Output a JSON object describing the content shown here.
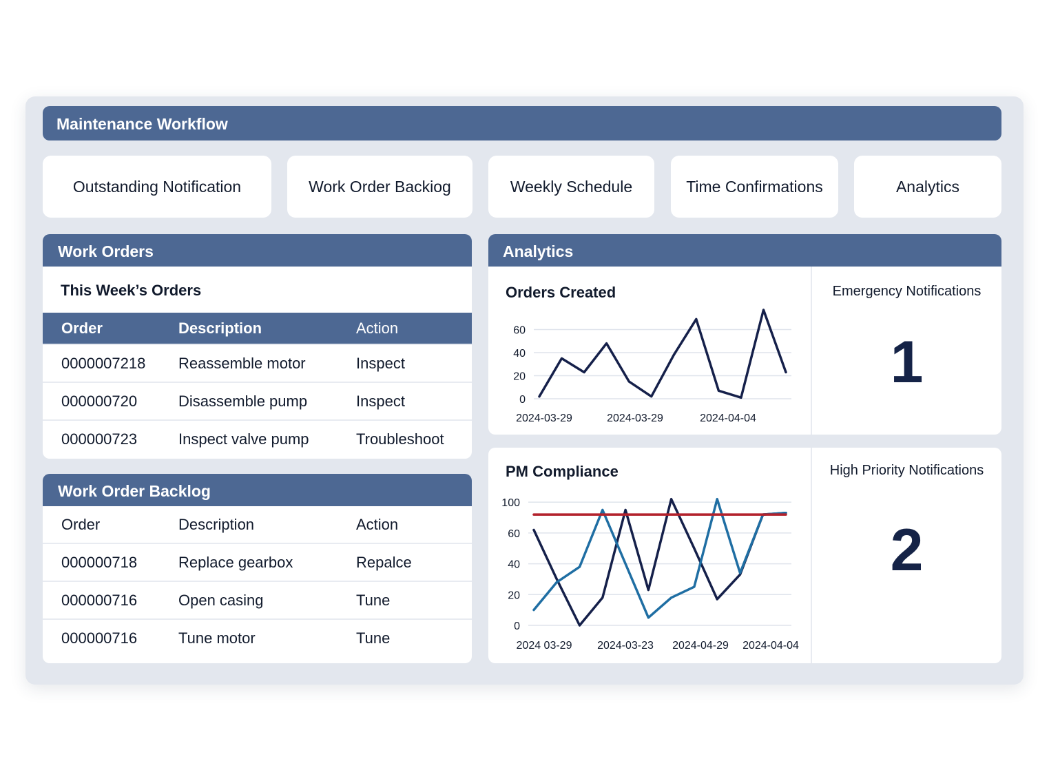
{
  "app": {
    "title": "Maintenance Workflow"
  },
  "tabs": [
    {
      "label": "Outstanding Notification"
    },
    {
      "label": "Work Order Backiog"
    },
    {
      "label": "Weekly Schedule"
    },
    {
      "label": "Time Confirmations"
    },
    {
      "label": "Analytics"
    }
  ],
  "work_orders": {
    "title": "Work Orders",
    "subtitle": "This Week’s Orders",
    "columns": [
      "Order",
      "Description",
      "Action"
    ],
    "rows": [
      {
        "order": "0000007218",
        "description": "Reassemble motor",
        "action": "Inspect"
      },
      {
        "order": "000000720",
        "description": "Disassemble pump",
        "action": "Inspect"
      },
      {
        "order": "000000723",
        "description": "Inspect valve pump",
        "action": "Troubleshoot"
      }
    ]
  },
  "backlog": {
    "title": "Work Order Backlog",
    "columns": [
      "Order",
      "Description",
      "Action"
    ],
    "rows": [
      {
        "order": "000000718",
        "description": "Replace gearbox",
        "action": "Repalce"
      },
      {
        "order": "000000716",
        "description": "Open casing",
        "action": "Tune"
      },
      {
        "order": "000000716",
        "description": "Tune motor",
        "action": "Tune"
      }
    ]
  },
  "analytics": {
    "title": "Analytics",
    "emergency": {
      "label": "Emergency Notifications",
      "value": "1"
    },
    "high_priority": {
      "label": "High Priority Notifications",
      "value": "2"
    }
  },
  "colors": {
    "header": "#4d6893",
    "frame": "#e3e7ee",
    "series_dark": "#15204a",
    "series_blue": "#1f6ea3",
    "target_red": "#b3222c"
  },
  "chart_data": [
    {
      "type": "line",
      "title": "Orders Created",
      "x_tick_labels": [
        "2024-03-29",
        "2024-03-29",
        "2024-04-04"
      ],
      "y_ticks": [
        0,
        20,
        40,
        60
      ],
      "ylim": [
        0,
        80
      ],
      "grid": true,
      "series": [
        {
          "values": [
            2,
            35,
            23,
            48,
            15,
            2,
            38,
            69,
            7,
            1,
            77,
            23
          ]
        }
      ]
    },
    {
      "type": "line",
      "title": "PM Compliance",
      "x_tick_labels": [
        "2024 03-29",
        "2024-03-23",
        "2024-04-29",
        "2024-04-04"
      ],
      "y_ticks": [
        0,
        20,
        40,
        60,
        100
      ],
      "y_tick_positions": [
        0,
        20,
        40,
        60,
        80
      ],
      "ylim": [
        0,
        85
      ],
      "grid": true,
      "series": [
        {
          "values": [
            62,
            30,
            0,
            18,
            75,
            23,
            82,
            50,
            17,
            33,
            72,
            73
          ]
        },
        {
          "values": [
            10,
            28,
            38,
            75,
            40,
            5,
            18,
            25,
            82,
            34,
            72,
            73
          ]
        },
        {
          "values": [
            72,
            72,
            72,
            72,
            72,
            72,
            72,
            72,
            72,
            72,
            72,
            72
          ]
        }
      ]
    }
  ]
}
